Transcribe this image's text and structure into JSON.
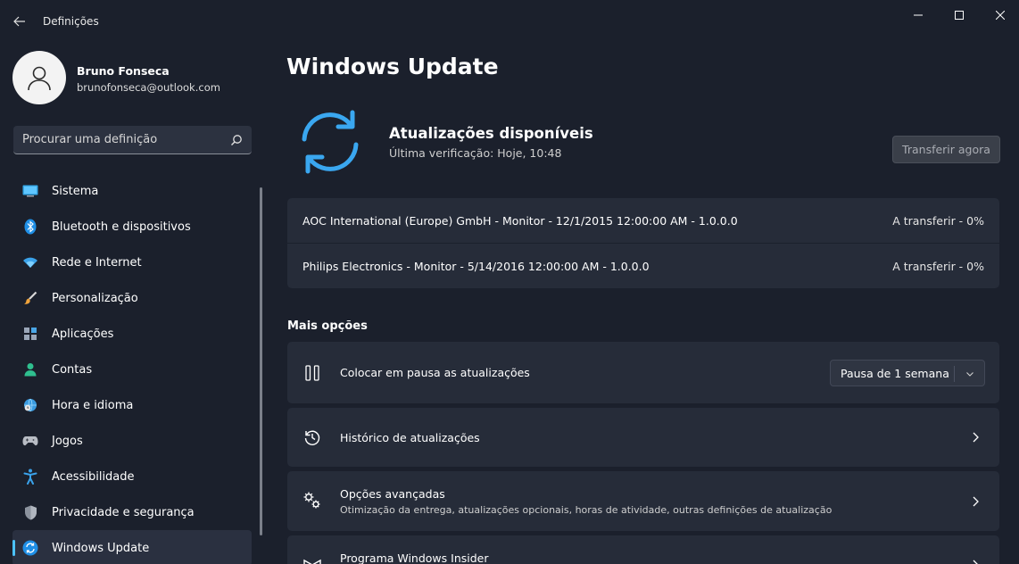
{
  "window": {
    "title": "Definições"
  },
  "profile": {
    "name": "Bruno Fonseca",
    "email": "brunofonseca@outlook.com"
  },
  "search": {
    "placeholder": "Procurar uma definição"
  },
  "sidebar": {
    "items": [
      {
        "label": "Sistema",
        "icon": "system-icon"
      },
      {
        "label": "Bluetooth e dispositivos",
        "icon": "bluetooth-icon"
      },
      {
        "label": "Rede e Internet",
        "icon": "wifi-icon"
      },
      {
        "label": "Personalização",
        "icon": "brush-icon"
      },
      {
        "label": "Aplicações",
        "icon": "apps-icon"
      },
      {
        "label": "Contas",
        "icon": "account-icon"
      },
      {
        "label": "Hora e idioma",
        "icon": "globe-clock-icon"
      },
      {
        "label": "Jogos",
        "icon": "gamepad-icon"
      },
      {
        "label": "Acessibilidade",
        "icon": "accessibility-icon"
      },
      {
        "label": "Privacidade e segurança",
        "icon": "shield-icon"
      },
      {
        "label": "Windows Update",
        "icon": "windows-update-icon",
        "active": true
      }
    ]
  },
  "main": {
    "title": "Windows Update",
    "status": {
      "title": "Atualizações disponíveis",
      "subtitle": "Última verificação: Hoje, 10:48",
      "button": "Transferir agora"
    },
    "updates": [
      {
        "name": "AOC International (Europe) GmbH - Monitor - 12/1/2015 12:00:00 AM - 1.0.0.0",
        "state": "A transferir - 0%"
      },
      {
        "name": "Philips Electronics - Monitor - 5/14/2016 12:00:00 AM - 1.0.0.0",
        "state": "A transferir - 0%"
      }
    ],
    "more_options_title": "Mais opções",
    "options": {
      "pause": {
        "label": "Colocar em pausa as atualizações",
        "select_value": "Pausa de 1 semana",
        "icon": "pause-icon"
      },
      "history": {
        "label": "Histórico de atualizações",
        "icon": "history-icon"
      },
      "advanced": {
        "label": "Opções avançadas",
        "subtitle": "Otimização da entrega, atualizações opcionais, horas de atividade, outras definições de atualização",
        "icon": "gears-icon"
      },
      "insider": {
        "label": "Programa Windows Insider",
        "icon": "insider-icon"
      }
    }
  },
  "colors": {
    "accent": "#4cc2ff",
    "background": "#1b202c",
    "card": "#262c39"
  }
}
